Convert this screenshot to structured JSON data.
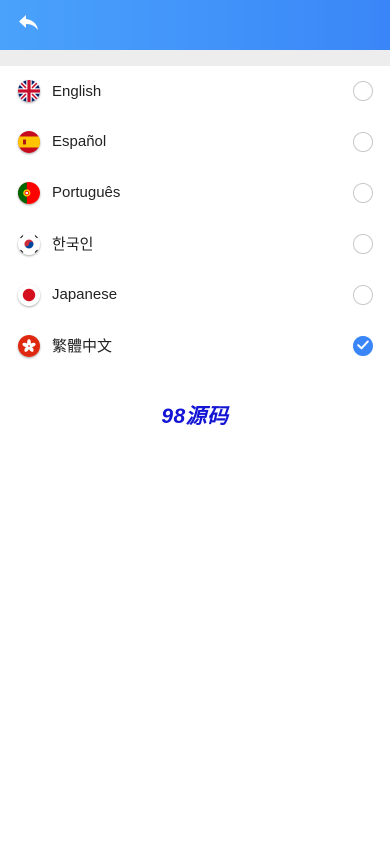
{
  "header": {
    "back_icon": "back-arrow-icon",
    "background_colors": [
      "#4aa2fb",
      "#3a86f8"
    ]
  },
  "languages": [
    {
      "label": "English",
      "flag": "uk-flag-icon",
      "selected": false
    },
    {
      "label": "Español",
      "flag": "spain-flag-icon",
      "selected": false
    },
    {
      "label": "Português",
      "flag": "portugal-flag-icon",
      "selected": false
    },
    {
      "label": "한국인",
      "flag": "korea-flag-icon",
      "selected": false
    },
    {
      "label": "Japanese",
      "flag": "japan-flag-icon",
      "selected": false
    },
    {
      "label": "繁體中文",
      "flag": "hongkong-flag-icon",
      "selected": true
    }
  ],
  "watermark": {
    "text": "98源码",
    "color": "#1414d4"
  },
  "colors": {
    "accent": "#3a86f8",
    "separator": "#ededed"
  }
}
